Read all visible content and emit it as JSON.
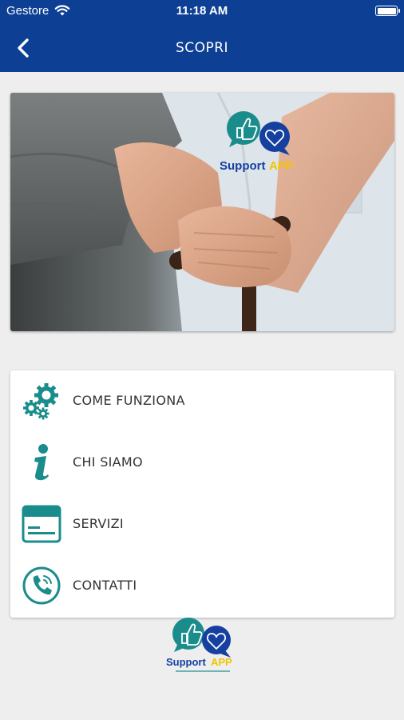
{
  "status_bar": {
    "carrier": "Gestore",
    "time": "11:18 AM"
  },
  "nav": {
    "title": "SCOPRI",
    "back_icon": "chevron-left-icon"
  },
  "brand": {
    "name_part1": "Support",
    "name_part2": "APP"
  },
  "menu": {
    "items": [
      {
        "label": "COME FUNZIONA",
        "icon": "gears-icon"
      },
      {
        "label": "CHI SIAMO",
        "icon": "info-icon"
      },
      {
        "label": "SERVIZI",
        "icon": "calendar-card-icon"
      },
      {
        "label": "CONTATTI",
        "icon": "phone-icon"
      }
    ]
  },
  "colors": {
    "primary": "#0d3f94",
    "accent": "#1b8c8c",
    "brand_yellow": "#f2c400",
    "background": "#eeeeee"
  }
}
